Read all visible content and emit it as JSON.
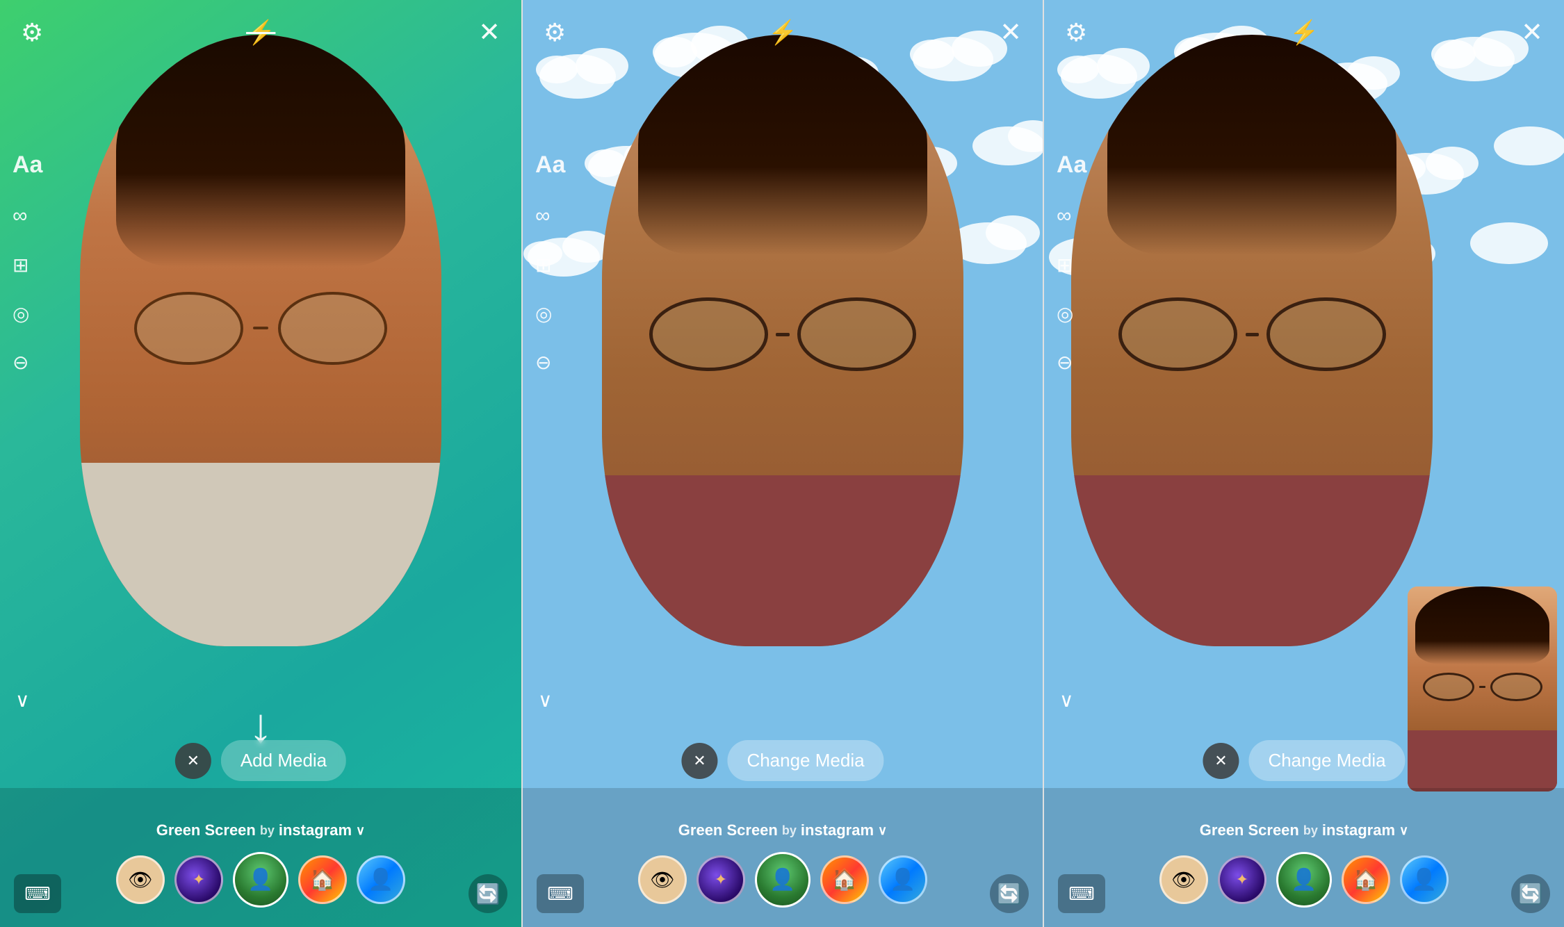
{
  "panels": [
    {
      "id": "panel-1",
      "bg_type": "green",
      "top_icons": {
        "settings": "⚙",
        "flash": "⚡",
        "close": "✕"
      },
      "sidebar": {
        "text_label": "Aa",
        "icons": [
          "∞",
          "⊞",
          "◎",
          "⊖"
        ]
      },
      "chevron": "∨",
      "media_button": {
        "has_close": true,
        "label": "Add Media",
        "show_arrow": true
      },
      "bottom": {
        "filter_label": "Green Screen",
        "filter_by": "instagram",
        "chevron": "∨",
        "filters": [
          "eye",
          "galaxy",
          "person-green",
          "home",
          "person-blue"
        ]
      },
      "bottom_actions": {
        "left": "keyboard",
        "right": "flip"
      }
    },
    {
      "id": "panel-2",
      "bg_type": "clouds",
      "top_icons": {
        "settings": "⚙",
        "flash": "⚡",
        "close": "✕"
      },
      "sidebar": {
        "text_label": "Aa",
        "icons": [
          "∞",
          "⊞",
          "◎",
          "⊖"
        ]
      },
      "chevron": "∨",
      "media_button": {
        "has_close": true,
        "label": "Change Media",
        "show_arrow": false
      },
      "bottom": {
        "filter_label": "Green Screen",
        "filter_by": "instagram",
        "chevron": "∨",
        "filters": [
          "eye",
          "galaxy",
          "person-green",
          "home",
          "person-blue"
        ]
      },
      "bottom_actions": {
        "left": "keyboard",
        "right": "flip"
      }
    },
    {
      "id": "panel-3",
      "bg_type": "clouds",
      "top_icons": {
        "settings": "⚙",
        "flash": "⚡",
        "close": "✕"
      },
      "sidebar": {
        "text_label": "Aa",
        "icons": [
          "∞",
          "⊞",
          "◎",
          "⊖"
        ]
      },
      "chevron": "∨",
      "media_button": {
        "has_close": true,
        "label": "Change Media",
        "show_arrow": false
      },
      "bottom": {
        "filter_label": "Green Screen",
        "filter_by": "instagram",
        "chevron": "∨",
        "filters": [
          "eye",
          "galaxy",
          "person-green",
          "home",
          "person-blue"
        ]
      },
      "bottom_actions": {
        "left": "keyboard",
        "right": "flip"
      },
      "has_overlay": true
    }
  ],
  "colors": {
    "green_bg_start": "#3ecf6e",
    "green_bg_end": "#1aa89e",
    "sky_blue": "#7bc8e8",
    "icon_white": "#ffffff",
    "media_btn_bg": "rgba(255,255,255,0.28)",
    "close_btn_bg": "rgba(60,60,60,0.85)"
  }
}
